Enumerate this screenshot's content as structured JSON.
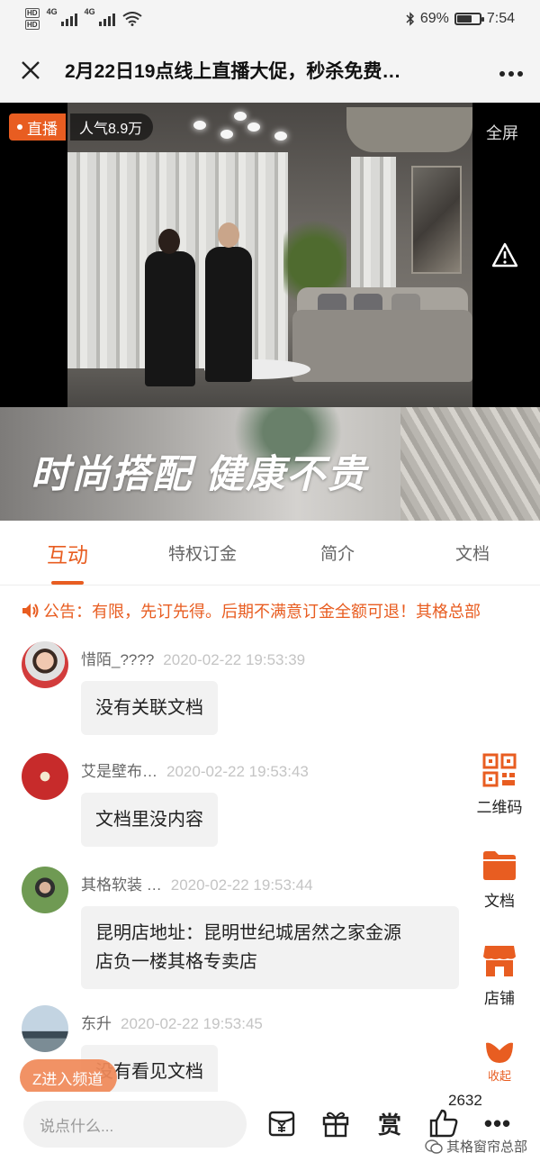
{
  "status_bar": {
    "network_1": "4G",
    "network_2": "4G",
    "battery_percent": "69%",
    "battery_level": 0.69,
    "time": "7:54",
    "icons": [
      "hd-icon",
      "signal-icon",
      "wifi-icon",
      "bluetooth-icon",
      "battery-icon"
    ]
  },
  "title_bar": {
    "title": "2月22日19点线上直播大促，秒杀免费…",
    "close_icon": "close-icon",
    "more_icon": "more-icon"
  },
  "video": {
    "live_label": "直播",
    "popularity": "人气8.9万",
    "fullscreen_label": "全屏",
    "warning_icon": "warning-icon"
  },
  "banner": {
    "text": "时尚搭配 健康不贵"
  },
  "tabs": [
    {
      "label": "互动",
      "active": true
    },
    {
      "label": "特权订金",
      "active": false
    },
    {
      "label": "简介",
      "active": false
    },
    {
      "label": "文档",
      "active": false
    }
  ],
  "notice": {
    "text": "公告：有限，先订先得。后期不满意订金全额可退！其格总部"
  },
  "messages": [
    {
      "user": "惜陌_????",
      "time": "2020-02-22 19:53:39",
      "lines": [
        "没有关联文档"
      ]
    },
    {
      "user": "艾是壁布…",
      "time": "2020-02-22 19:53:43",
      "lines": [
        "文档里没内容"
      ]
    },
    {
      "user": "其格软装 …",
      "time": "2020-02-22 19:53:44",
      "lines": [
        "昆明店地址：昆明世纪城居然之家金源",
        "店负一楼其格专卖店"
      ]
    },
    {
      "user": "东升",
      "time": "2020-02-22 19:53:45",
      "lines": [
        "没有看见文档"
      ]
    }
  ],
  "side_actions": [
    {
      "label": "二维码",
      "icon": "qrcode-icon"
    },
    {
      "label": "文档",
      "icon": "folder-icon"
    },
    {
      "label": "店铺",
      "icon": "store-icon"
    },
    {
      "label": "收起",
      "icon": "collapse-icon"
    }
  ],
  "colors": {
    "accent": "#e85d21",
    "bubble": "#f2f2f2"
  },
  "enter_channel": "Z进入频道",
  "bottom_bar": {
    "input_placeholder": "说点什么...",
    "reward_label": "赏",
    "like_count": "2632",
    "more_label": "•••",
    "icons": [
      "red-packet-icon",
      "gift-icon",
      "reward-icon",
      "like-icon",
      "more-icon"
    ]
  },
  "watermark": "其格窗帘总部"
}
